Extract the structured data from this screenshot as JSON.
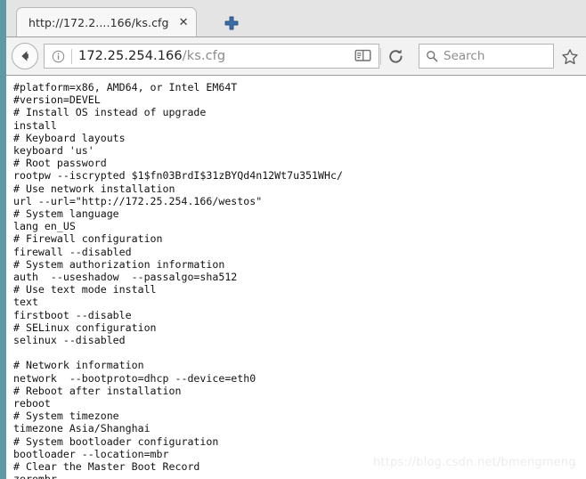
{
  "browser": {
    "tab": {
      "title": "http://172.2....166/ks.cfg",
      "close_label": "✕"
    },
    "new_tab_label": "+",
    "toolbar": {
      "back_label": "Back",
      "info_label": "Site information",
      "url_domain": "172.25.254.166",
      "url_path": "/ks.cfg",
      "reader_label": "Reader view",
      "reload_label": "Reload",
      "search_placeholder": "Search",
      "search_value": "",
      "bookmark_label": "Bookmark this page"
    }
  },
  "page": {
    "filename": "ks.cfg",
    "content": "#platform=x86, AMD64, or Intel EM64T\n#version=DEVEL\n# Install OS instead of upgrade\ninstall\n# Keyboard layouts\nkeyboard 'us'\n# Root password\nrootpw --iscrypted $1$fn03BrdI$31zBYQd4n12Wt7u351WHc/\n# Use network installation\nurl --url=\"http://172.25.254.166/westos\"\n# System language\nlang en_US\n# Firewall configuration\nfirewall --disabled\n# System authorization information\nauth  --useshadow  --passalgo=sha512\n# Use text mode install\ntext\nfirstboot --disable\n# SELinux configuration\nselinux --disabled\n\n# Network information\nnetwork  --bootproto=dhcp --device=eth0\n# Reboot after installation\nreboot\n# System timezone\ntimezone Asia/Shanghai\n# System bootloader configuration\nbootloader --location=mbr\n# Clear the Master Boot Record\nzerombr",
    "lines": [
      "#platform=x86, AMD64, or Intel EM64T",
      "#version=DEVEL",
      "# Install OS instead of upgrade",
      "install",
      "# Keyboard layouts",
      "keyboard 'us'",
      "# Root password",
      "rootpw --iscrypted $1$fn03BrdI$31zBYQd4n12Wt7u351WHc/",
      "# Use network installation",
      "url --url=\"http://172.25.254.166/westos\"",
      "# System language",
      "lang en_US",
      "# Firewall configuration",
      "firewall --disabled",
      "# System authorization information",
      "auth  --useshadow  --passalgo=sha512",
      "# Use text mode install",
      "text",
      "firstboot --disable",
      "# SELinux configuration",
      "selinux --disabled",
      "",
      "# Network information",
      "network  --bootproto=dhcp --device=eth0",
      "# Reboot after installation",
      "reboot",
      "# System timezone",
      "timezone Asia/Shanghai",
      "# System bootloader configuration",
      "bootloader --location=mbr",
      "# Clear the Master Boot Record",
      "zerombr"
    ]
  },
  "watermark": {
    "text": "https://blog.csdn.net/bmengmeng"
  },
  "colors": {
    "edge_strip": "#5c9aa5",
    "tabbar_bg": "#e4e4e4",
    "toolbar_bg": "#f2f2f2",
    "tab_bg": "#f7f7f7",
    "content_bg": "#ffffff",
    "text": "#121212",
    "url_path": "#8b8b8b",
    "newtab_blue": "#3b6ea8",
    "watermark": "#ececec"
  }
}
